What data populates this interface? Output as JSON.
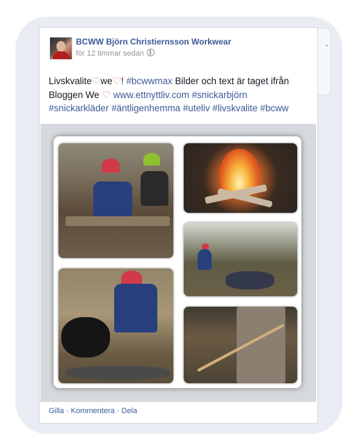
{
  "post": {
    "author": "BCWW Björn Christiernsson Workwear",
    "time": "för 12 timmar sedan",
    "text": {
      "p1": "Livskvalite",
      "p2": "we",
      "p3": "! ",
      "hashtag_bcwwmax": "#bcwwmax",
      "p4": " Bilder och text är taget ifrån Bloggen We ",
      "link": "www.ettnyttliv.com",
      "p5": " ",
      "tag1": "#snickarbjörn",
      "tag2": "#snickarkläder",
      "tag3": "#äntligenhemma",
      "tag4": "#uteliv",
      "tag5": "#livskvalite",
      "tag6": "#bcww"
    },
    "heart": "♡",
    "actions": "Gilla · Kommentera · Dela"
  },
  "colors": {
    "link": "#3b5998",
    "heart": "#e86a7a",
    "bubble": "#e9edf3"
  }
}
